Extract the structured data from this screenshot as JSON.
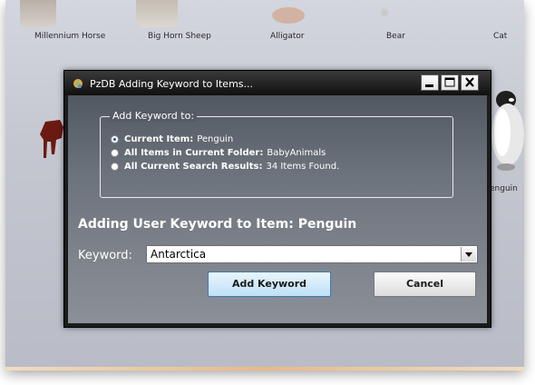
{
  "background": {
    "thumbnails": [
      {
        "caption": "Millennium Horse"
      },
      {
        "caption": "Big Horn Sheep"
      },
      {
        "caption": "Alligator"
      },
      {
        "caption": "Bear"
      },
      {
        "caption": "Cat"
      }
    ],
    "side_caption": "enguin"
  },
  "dialog": {
    "title": "PzDB Adding Keyword to Items...",
    "window_buttons": {
      "minimize_icon": "minimize-icon",
      "maximize_icon": "maximize-icon",
      "close_icon": "close-icon"
    },
    "group": {
      "legend": "Add Keyword to:",
      "options": [
        {
          "label": "Current Item:",
          "value": "Penguin",
          "selected": true
        },
        {
          "label": "All Items in Current Folder:",
          "value": "BabyAnimals",
          "selected": false
        },
        {
          "label": "All Current Search Results:",
          "value": "34 Items Found.",
          "selected": false
        }
      ]
    },
    "heading": "Adding User Keyword to Item: Penguin",
    "keyword_label": "Keyword:",
    "keyword_value": "Antarctica",
    "add_button": "Add Keyword",
    "cancel_button": "Cancel"
  },
  "colors": {
    "dialog_frame": "#1b1b1b",
    "primary_button": "#bfe0f7",
    "selected_radio": "#1a4fb5"
  }
}
